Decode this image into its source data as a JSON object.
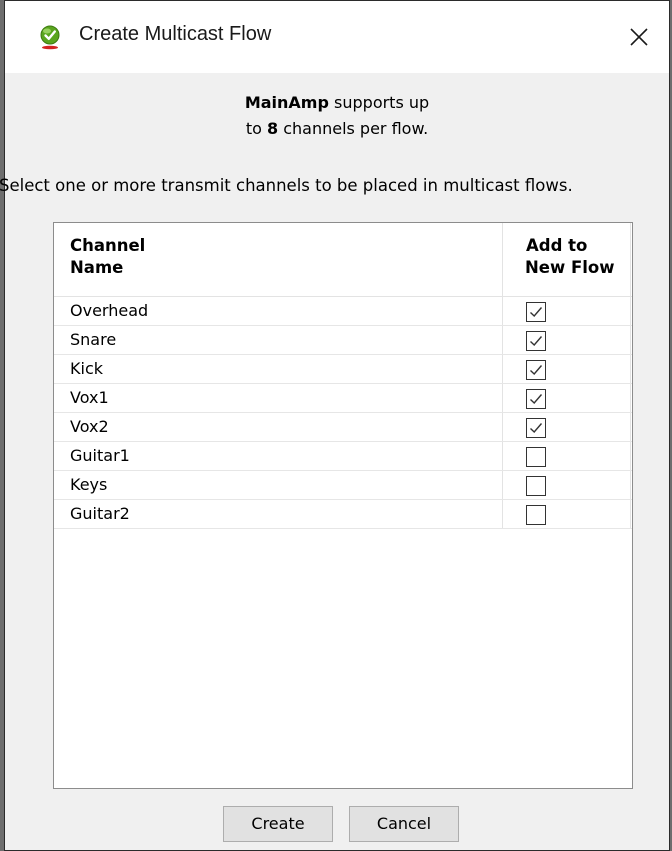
{
  "dialog": {
    "title": "Create Multicast Flow",
    "icon": "green-check-globe-icon",
    "close_icon": "close-icon"
  },
  "info": {
    "device_name": "MainAmp",
    "line1_suffix": " supports up",
    "line2_prefix": "to ",
    "max_channels": "8",
    "line2_suffix": " channels per flow."
  },
  "instructions": "Select one or more transmit channels to be placed in multicast flows.",
  "table": {
    "headers": {
      "channel_line1": "Channel",
      "channel_line2": "Name",
      "add_line1": "Add to",
      "add_line2": "New Flow"
    },
    "rows": [
      {
        "name": "Overhead",
        "checked": true
      },
      {
        "name": "Snare",
        "checked": true
      },
      {
        "name": "Kick",
        "checked": true
      },
      {
        "name": "Vox1",
        "checked": true
      },
      {
        "name": "Vox2",
        "checked": true
      },
      {
        "name": "Guitar1",
        "checked": false
      },
      {
        "name": "Keys",
        "checked": false
      },
      {
        "name": "Guitar2",
        "checked": false
      }
    ]
  },
  "buttons": {
    "create": "Create",
    "cancel": "Cancel"
  },
  "colors": {
    "titlebar": "#ffffff",
    "dialog_bg": "#f0f0f0",
    "button_bg": "#e1e1e1",
    "icon_green": "#5aa51e"
  }
}
